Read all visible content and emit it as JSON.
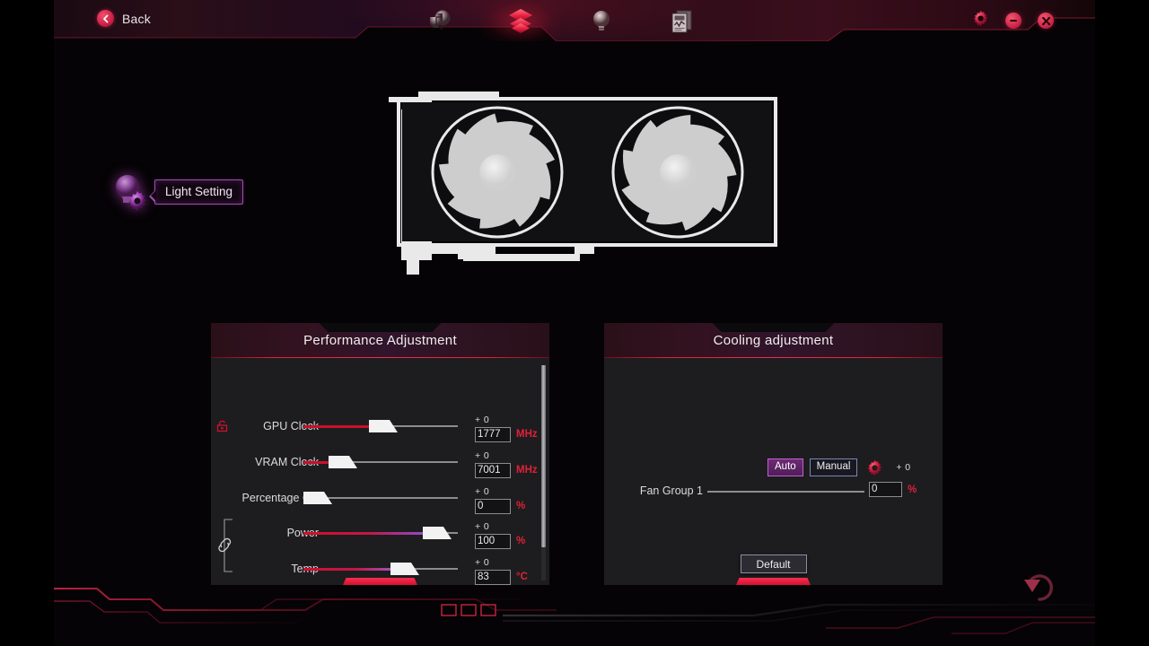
{
  "header": {
    "back_label": "Back",
    "back_icon": "chevron-left-icon",
    "nav": [
      {
        "id": "tuning",
        "icon": "puzzle-tuning-icon",
        "active": false
      },
      {
        "id": "oc-scanner",
        "icon": "layers-icon",
        "active": true
      },
      {
        "id": "lighting",
        "icon": "lightbulb-icon",
        "active": false
      },
      {
        "id": "monitoring",
        "icon": "monitor-chart-icon",
        "active": false
      }
    ],
    "window_controls": [
      {
        "id": "settings",
        "icon": "gear-icon"
      },
      {
        "id": "minimize",
        "icon": "minus-icon"
      },
      {
        "id": "close",
        "icon": "close-icon"
      }
    ]
  },
  "light_setting": {
    "icon": "light-bulb-gear-icon",
    "label": "Light Setting"
  },
  "gpu_card": {
    "icon": "dual-fan-graphics-card",
    "fan_count": 2,
    "fan_blades": 9
  },
  "performance_panel": {
    "title": "Performance Adjustment",
    "rows": [
      {
        "label": "GPU Clock",
        "offset": "+ 0",
        "value": "1777",
        "unit": "MHz",
        "fill_pct": 50,
        "handle_pct": 50,
        "fill_color": "#c8102e",
        "locked": true
      },
      {
        "label": "VRAM Clock",
        "offset": "+ 0",
        "value": "7001",
        "unit": "MHz",
        "fill_pct": 25,
        "handle_pct": 25,
        "fill_color": "#c8102e",
        "locked": false
      },
      {
        "label": "Percentage OV",
        "offset": "+ 0",
        "value": "0",
        "unit": "%",
        "fill_pct": 0,
        "handle_pct": 0,
        "fill_color": "#c8102e",
        "locked": false
      },
      {
        "label": "Power",
        "offset": "+ 0",
        "value": "100",
        "unit": "%",
        "fill_pct": 82,
        "handle_pct": 82,
        "fill_color": "linear-gradient(90deg,#d0102c 0%,#c2174a 52%,#8d4fd8 100%)",
        "locked": false
      },
      {
        "label": "Temp",
        "offset": "+ 0",
        "value": "83",
        "unit": "°C",
        "fill_pct": 62,
        "handle_pct": 62,
        "fill_color": "linear-gradient(90deg,#d0102c 0%,#c2174a 55%,#9a5fd0 100%)",
        "locked": false
      }
    ],
    "link_icon": "chain-link-icon",
    "scroll_thumb_pct": 84
  },
  "cooling_panel": {
    "title": "Cooling adjustment",
    "mode_buttons": [
      {
        "label": "Auto",
        "selected": true
      },
      {
        "label": "Manual",
        "selected": false
      }
    ],
    "fan_gear_icon": "gear-icon",
    "fan_offset": "+ 0",
    "fan_label": "Fan Group 1",
    "fan_value": "0",
    "fan_unit": "%",
    "fan_fill_pct": 0,
    "default_button": "Default"
  },
  "footer": {
    "reset_icon": "circular-reset-arrow-icon"
  },
  "colors": {
    "accent_red": "#e02038",
    "panel_bg": "#1d1d1f",
    "purple": "#9b4fae"
  }
}
